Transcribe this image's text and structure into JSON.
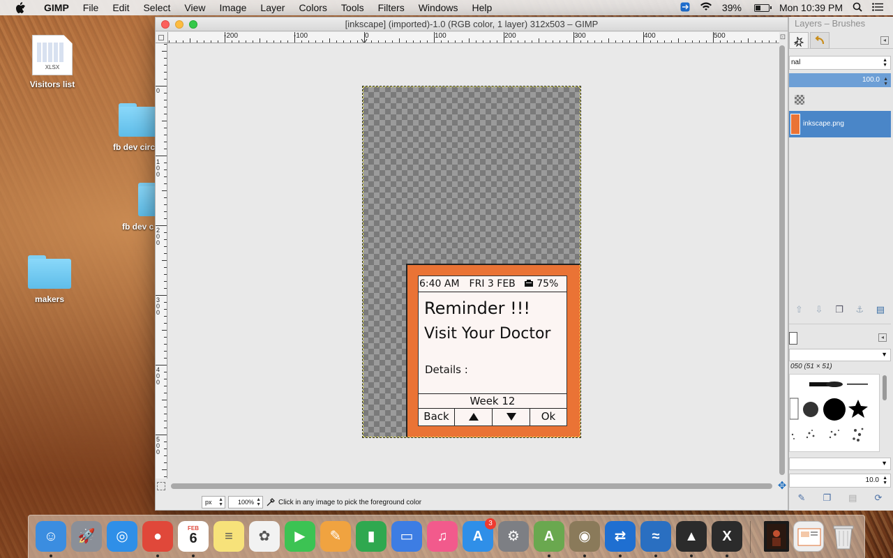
{
  "menubar": {
    "app_name": "GIMP",
    "menus": [
      "File",
      "Edit",
      "Select",
      "View",
      "Image",
      "Layer",
      "Colors",
      "Tools",
      "Filters",
      "Windows",
      "Help"
    ],
    "battery_percent": "39%",
    "battery_level": 0.39,
    "clock": "Mon 10:39 PM"
  },
  "desktop": {
    "icons": [
      {
        "label": "Visitors list",
        "kind": "xlsx",
        "ext": "XLSX"
      },
      {
        "label": "fb dev circ",
        "kind": "folder"
      },
      {
        "label": "fb dev c",
        "kind": "folder"
      },
      {
        "label": "makers",
        "kind": "folder"
      }
    ]
  },
  "gimp_window": {
    "title": "[inkscape] (imported)-1.0 (RGB color, 1 layer) 312x503 – GIMP",
    "ruler_h_labels": [
      "-200",
      "-100",
      "0",
      "100",
      "200",
      "300",
      "400",
      "500"
    ],
    "ruler_v_labels": [
      "0",
      "100",
      "200",
      "300",
      "400",
      "500"
    ],
    "statusbar": {
      "unit": "px",
      "zoom": "100%",
      "message": "Click in any image to pick the foreground color"
    }
  },
  "device_screen": {
    "time": "6:40 AM",
    "date": "FRI 3 FEB",
    "battery": "75%",
    "title": "Reminder !!!",
    "message": "Visit Your Doctor",
    "details_label": "Details :",
    "week": "Week 12",
    "buttons": {
      "back": "Back",
      "ok": "Ok"
    }
  },
  "dock_panel": {
    "title": "Layers – Brushes",
    "mode": "nal",
    "opacity": "100.0",
    "layer_name": "inkscape.png",
    "brush_name": "050 (51 × 51)",
    "spacing": "10.0"
  },
  "dock": {
    "apps": [
      {
        "name": "finder",
        "color": "#3b8de0",
        "glyph": "☺"
      },
      {
        "name": "launchpad",
        "color": "#8a8f98",
        "glyph": "🚀"
      },
      {
        "name": "safari",
        "color": "#2f8fe8",
        "glyph": "◎"
      },
      {
        "name": "chrome",
        "color": "#e0483a",
        "glyph": "●"
      },
      {
        "name": "calendar",
        "color": "#ffffff",
        "glyph": "6"
      },
      {
        "name": "notes",
        "color": "#f7e27a",
        "glyph": "≡"
      },
      {
        "name": "photos",
        "color": "#f2f2f2",
        "glyph": "✿"
      },
      {
        "name": "facetime",
        "color": "#3cc353",
        "glyph": "▶"
      },
      {
        "name": "pages",
        "color": "#f0a340",
        "glyph": "✎"
      },
      {
        "name": "numbers",
        "color": "#2fa84f",
        "glyph": "▮"
      },
      {
        "name": "keynote",
        "color": "#3d7de3",
        "glyph": "▭"
      },
      {
        "name": "itunes",
        "color": "#f25a8c",
        "glyph": "♫"
      },
      {
        "name": "app-store",
        "color": "#2f8fe8",
        "glyph": "A"
      },
      {
        "name": "system-preferences",
        "color": "#7d7f84",
        "glyph": "⚙"
      },
      {
        "name": "android-studio",
        "color": "#6aa84f",
        "glyph": "A"
      },
      {
        "name": "gimp",
        "color": "#8a7a5a",
        "glyph": "◉"
      },
      {
        "name": "teamviewer",
        "color": "#1f6fd1",
        "glyph": "⇄"
      },
      {
        "name": "wireshark",
        "color": "#2a6fc1",
        "glyph": "≈"
      },
      {
        "name": "inkscape",
        "color": "#2b2b2b",
        "glyph": "▲"
      },
      {
        "name": "xquartz",
        "color": "#2b2b2b",
        "glyph": "X"
      }
    ],
    "calendar_month": "FEB",
    "app_store_badge": "3"
  }
}
